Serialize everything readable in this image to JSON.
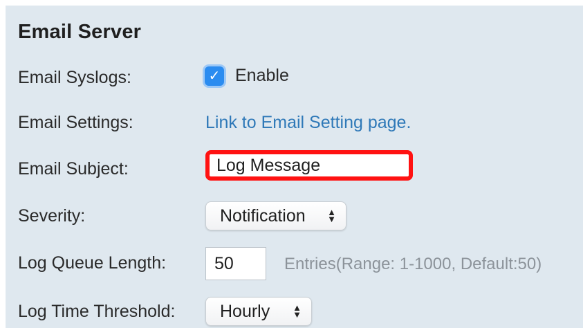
{
  "section": {
    "title": "Email Server"
  },
  "fields": {
    "email_syslogs": {
      "label": "Email Syslogs:",
      "checkbox_label": "Enable",
      "checked": true,
      "check_icon": "checkmark-icon"
    },
    "email_settings": {
      "label": "Email Settings:",
      "link_text": "Link to Email Setting page."
    },
    "email_subject": {
      "label": "Email Subject:",
      "value": "Log Message"
    },
    "severity": {
      "label": "Severity:",
      "selected": "Notification",
      "arrows_icon": "select-arrows-icon"
    },
    "log_queue_length": {
      "label": "Log Queue Length:",
      "value": "50",
      "hint": "Entries(Range: 1-1000, Default:50)"
    },
    "log_time_threshold": {
      "label": "Log Time Threshold:",
      "selected": "Hourly",
      "arrows_icon": "select-arrows-icon"
    }
  },
  "colors": {
    "panel_background": "#dfe8ef",
    "link": "#2f79b8",
    "highlight_border": "#ff1212",
    "checkbox": "#2b8cf0",
    "hint_text": "#8c939a"
  }
}
